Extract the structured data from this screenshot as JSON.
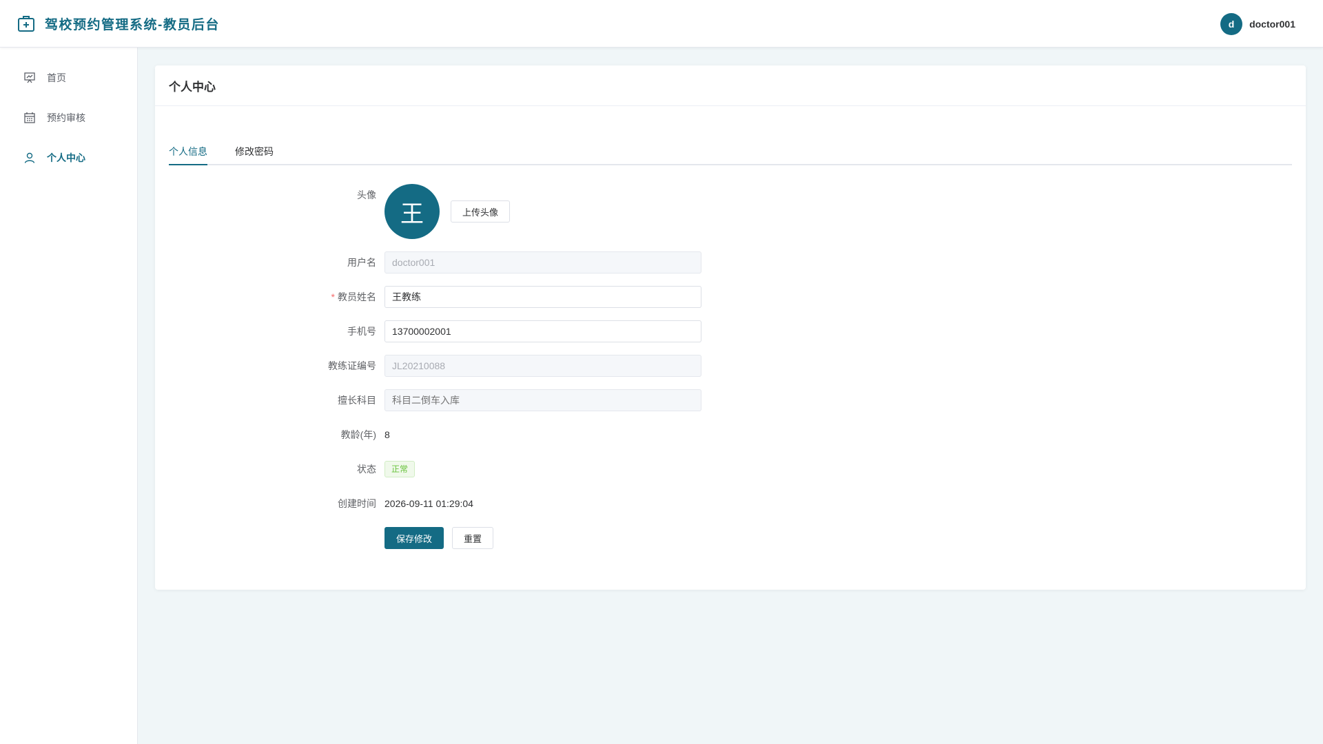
{
  "header": {
    "title": "驾校预约管理系统-教员后台",
    "user": {
      "avatar_letter": "d",
      "name": "doctor001"
    }
  },
  "sidebar": {
    "items": [
      {
        "label": "首页",
        "icon": "presentation-board-icon",
        "active": false
      },
      {
        "label": "预约审核",
        "icon": "calendar-icon",
        "active": false
      },
      {
        "label": "个人中心",
        "icon": "user-icon",
        "active": true
      }
    ]
  },
  "main": {
    "card_title": "个人中心",
    "tabs": [
      {
        "label": "个人信息",
        "active": true
      },
      {
        "label": "修改密码",
        "active": false
      }
    ],
    "form": {
      "avatar": {
        "label": "头像",
        "letter": "王",
        "upload_label": "上传头像"
      },
      "username": {
        "label": "用户名",
        "value": "doctor001",
        "disabled": true
      },
      "coach_name": {
        "label": "教员姓名",
        "value": "王教练",
        "required": true
      },
      "phone": {
        "label": "手机号",
        "value": "13700002001"
      },
      "license_no": {
        "label": "教练证编号",
        "value": "JL20210088",
        "disabled": true
      },
      "specialty": {
        "label": "擅长科目",
        "placeholder": "科目二倒车入库",
        "disabled": true
      },
      "teaching_years": {
        "label": "教龄(年)",
        "value": "8"
      },
      "status": {
        "label": "状态",
        "value": "正常"
      },
      "created_at": {
        "label": "创建时间",
        "value": "2026-09-11 01:29:04"
      },
      "buttons": {
        "save_label": "保存修改",
        "reset_label": "重置"
      }
    }
  },
  "colors": {
    "primary": "#146b84",
    "background": "#f0f6f8",
    "success": "#67c23a",
    "required": "#f56c6c"
  }
}
